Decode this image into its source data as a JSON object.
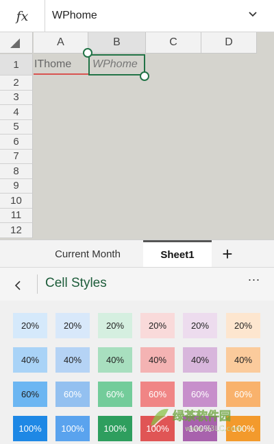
{
  "formula_bar": {
    "fx_label": "fx",
    "value": "WPhome"
  },
  "columns": [
    {
      "label": "A",
      "selected": false
    },
    {
      "label": "B",
      "selected": true
    },
    {
      "label": "C",
      "selected": false
    },
    {
      "label": "D",
      "selected": false
    }
  ],
  "rows": [
    "1",
    "2",
    "3",
    "4",
    "5",
    "6",
    "7",
    "8",
    "9",
    "10",
    "11",
    "12"
  ],
  "cells": {
    "A1": "IThome",
    "B1": "WPhome"
  },
  "sheet_tabs": {
    "current_month": "Current Month",
    "sheet1": "Sheet1",
    "add_label": "+"
  },
  "panel": {
    "back_label": "<",
    "title": "Cell Styles",
    "more_label": "..."
  },
  "style_swatches": {
    "rows": [
      [
        "20%",
        "20%",
        "20%",
        "20%",
        "20%",
        "20%"
      ],
      [
        "40%",
        "40%",
        "40%",
        "40%",
        "40%",
        "40%"
      ],
      [
        "60%",
        "60%",
        "60%",
        "60%",
        "60%",
        "60%"
      ],
      [
        "100%",
        "100%",
        "100%",
        "100%",
        "100%",
        "100%"
      ]
    ],
    "colors": [
      [
        "#d5e9fb",
        "#d8e8fa",
        "#d5efe0",
        "#f9dada",
        "#eddcee",
        "#fde6cf"
      ],
      [
        "#a9d3f7",
        "#b5d3f5",
        "#a8dfbf",
        "#f4b3b3",
        "#d8b6dc",
        "#fbcb9c"
      ],
      [
        "#6cb6f2",
        "#93c0f0",
        "#73cc9a",
        "#f08585",
        "#c78fcb",
        "#f9b26c"
      ],
      [
        "#1e88e5",
        "#5aa3ee",
        "#2e9e5e",
        "#e05555",
        "#a862ad",
        "#f39a2c"
      ]
    ]
  },
  "watermark": {
    "text": "绿茶软件园",
    "url": "www.33LC.com"
  }
}
